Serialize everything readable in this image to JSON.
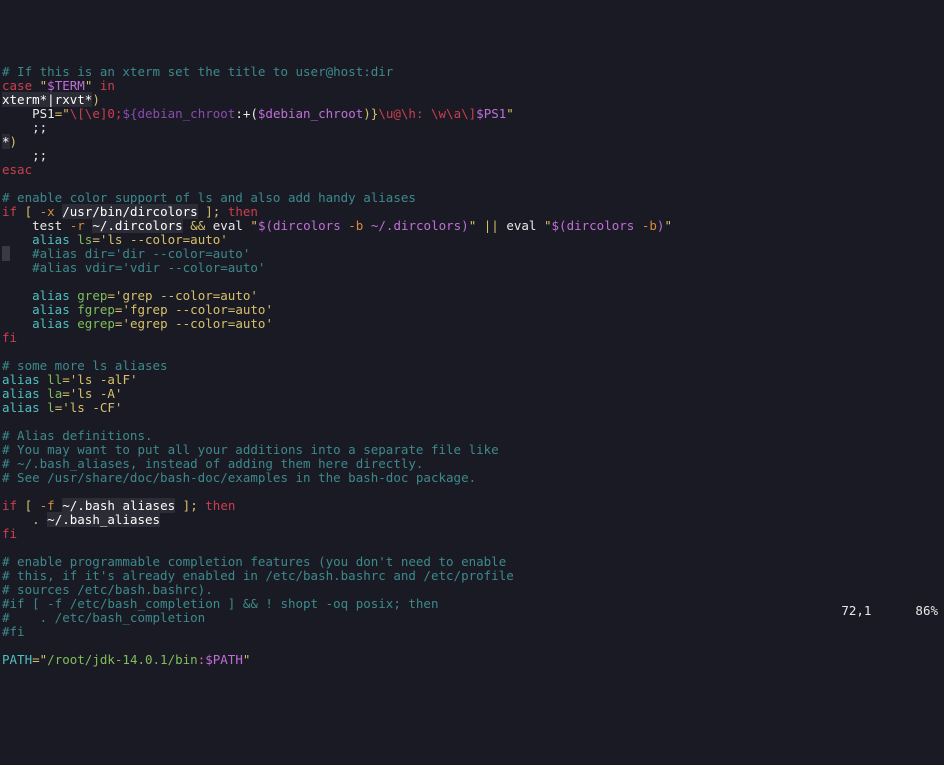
{
  "status": {
    "position": "72,1",
    "percent": "86%"
  },
  "lines": [
    {
      "t": "comment",
      "text": "# If this is an xterm set the title to user@host:dir"
    },
    {
      "t": "case"
    },
    {
      "t": "xterm"
    },
    {
      "t": "ps1"
    },
    {
      "t": "dsemi"
    },
    {
      "t": "star"
    },
    {
      "t": "dsemi2"
    },
    {
      "t": "esac"
    },
    {
      "t": "blank"
    },
    {
      "t": "comment",
      "text": "# enable color support of ls and also add handy aliases"
    },
    {
      "t": "ifdircolors"
    },
    {
      "t": "testdircolors"
    },
    {
      "t": "alias_ls"
    },
    {
      "t": "cmtline",
      "text": "    #alias dir='dir --color=auto'",
      "sel": true
    },
    {
      "t": "cmtline",
      "text": "    #alias vdir='vdir --color=auto'"
    },
    {
      "t": "blank"
    },
    {
      "t": "alias_grep"
    },
    {
      "t": "alias_fgrep"
    },
    {
      "t": "alias_egrep"
    },
    {
      "t": "fi"
    },
    {
      "t": "blank"
    },
    {
      "t": "comment",
      "text": "# some more ls aliases"
    },
    {
      "t": "alias_ll"
    },
    {
      "t": "alias_la"
    },
    {
      "t": "alias_l"
    },
    {
      "t": "blank"
    },
    {
      "t": "comment",
      "text": "# Alias definitions."
    },
    {
      "t": "comment",
      "text": "# You may want to put all your additions into a separate file like"
    },
    {
      "t": "comment",
      "text": "# ~/.bash_aliases, instead of adding them here directly."
    },
    {
      "t": "comment",
      "text": "# See /usr/share/doc/bash-doc/examples in the bash-doc package."
    },
    {
      "t": "blank"
    },
    {
      "t": "ifbashaliases"
    },
    {
      "t": "sourcebashaliases"
    },
    {
      "t": "fi"
    },
    {
      "t": "blank"
    },
    {
      "t": "comment",
      "text": "# enable programmable completion features (you don't need to enable"
    },
    {
      "t": "comment",
      "text": "# this, if it's already enabled in /etc/bash.bashrc and /etc/profile"
    },
    {
      "t": "comment",
      "text": "# sources /etc/bash.bashrc)."
    },
    {
      "t": "comment",
      "text": "#if [ -f /etc/bash_completion ] && ! shopt -oq posix; then"
    },
    {
      "t": "comment",
      "text": "#    . /etc/bash_completion"
    },
    {
      "t": "comment",
      "text": "#fi"
    },
    {
      "t": "blank"
    },
    {
      "t": "pathline"
    }
  ],
  "tokens": {
    "case_kw": "case",
    "in_kw": "in",
    "esac_kw": "esac",
    "term_var": "$TERM",
    "xterm_pat": "xterm*|rxvt*",
    "ps1_var": "PS1",
    "ps1_prefix": "\\[\\e]0;",
    "deb1": "${debian_chroot",
    "deb_colon": ":+(",
    "deb2": "$debian_chroot",
    "deb_close": ")}",
    "ps1_suffix": "\\u@\\h: \\w\\a\\]",
    "ps1_tail": "$PS1",
    "dsemi": ";;",
    "star": "*",
    "if_kw": "if",
    "then_kw": "then",
    "fi_kw": "fi",
    "lb": "[",
    "rb": "]",
    "dash_x": "-x",
    "dash_f": "-f",
    "dash_r": "-r",
    "dash_b": "-b",
    "dircolors_path": "/usr/bin/dircolors",
    "dircolors_file": "~/.dircolors",
    "bash_aliases": "~/.bash_aliases",
    "test_cmd": "test",
    "eval_cmd": "eval",
    "dircolors_cmd": "dircolors",
    "amp": "&&",
    "pipe": "||",
    "alias_kw": "alias",
    "dot_cmd": ".",
    "ls": "ls",
    "ll": "ll",
    "la": "la",
    "l": "l",
    "grep": "grep",
    "fgrep": "fgrep",
    "egrep": "egrep",
    "ls_str": "'ls --color=auto'",
    "grep_str": "'grep --color=auto'",
    "fgrep_str": "'fgrep --color=auto'",
    "egrep_str": "'egrep --color=auto'",
    "ll_str": "'ls -alF'",
    "la_str": "'ls -A'",
    "l_str": "'ls -CF'",
    "path_var": "PATH",
    "path_str_pre": "/root/jdk-14.0.1/bin",
    "path_colon": ":",
    "path_var_ref": "$PATH",
    "sc": ";",
    "eq": "=",
    "q": "\"",
    "sq": "'",
    "dollar_open": "$(",
    "close_paren": ")"
  }
}
